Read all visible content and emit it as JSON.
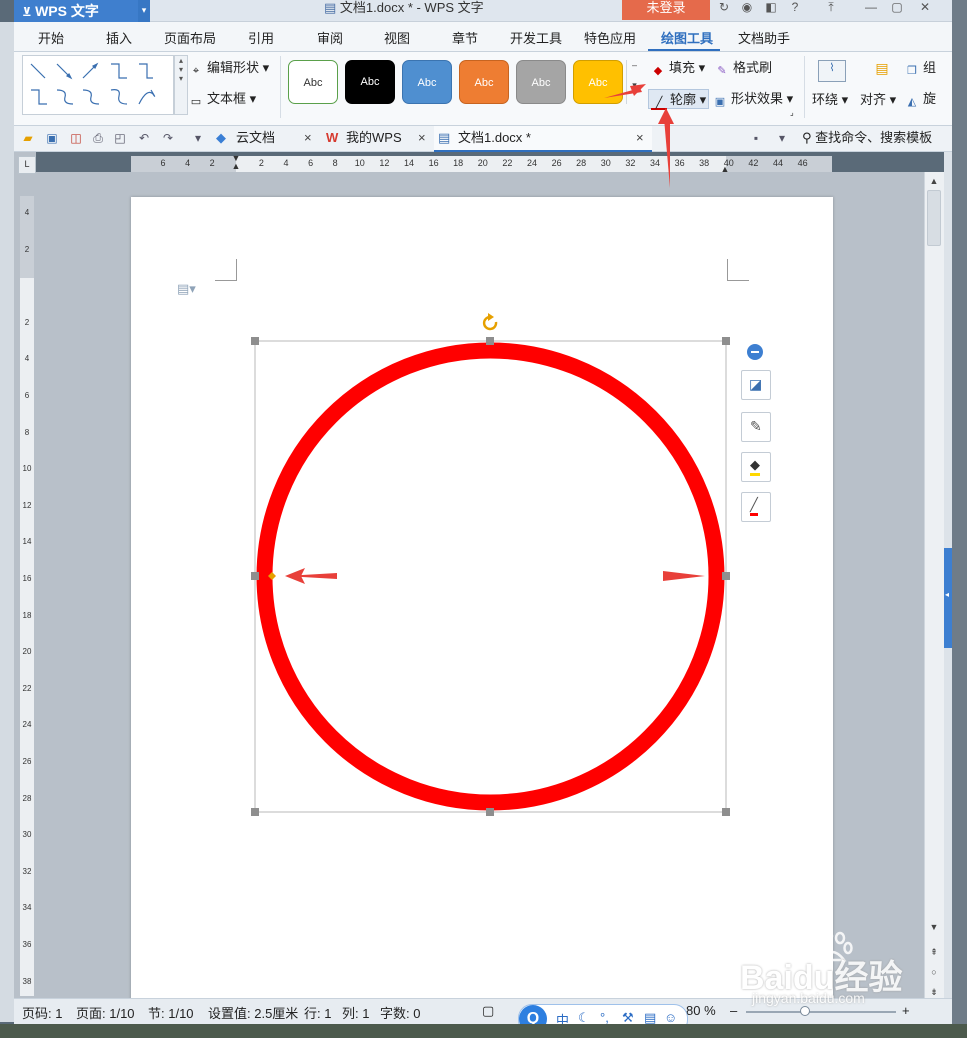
{
  "window": {
    "app_name": "WPS 文字",
    "title": "文档1.docx * - WPS 文字",
    "login_label": "未登录"
  },
  "ribbon_tabs": [
    "开始",
    "插入",
    "页面布局",
    "引用",
    "审阅",
    "视图",
    "章节",
    "开发工具",
    "特色应用",
    "绘图工具",
    "文档助手"
  ],
  "active_tab": "绘图工具",
  "ribbon": {
    "edit_shape_label": "编辑形状",
    "text_box_label": "文本框",
    "style_sample_label": "Abc",
    "style_colors": [
      "#ffffff",
      "#000000",
      "#4f8fd0",
      "#ee7d32",
      "#a5a5a5",
      "#ffc000"
    ],
    "fill_label": "填充",
    "format_painter_label": "格式刷",
    "outline_label": "轮廓",
    "shape_effect_label": "形状效果",
    "wrap_label": "环绕",
    "align_label": "对齐",
    "group_label": "组",
    "rotate_label": "旋"
  },
  "doc_tabs": [
    {
      "label": "云文档",
      "icon": "cloud-doc-icon"
    },
    {
      "label": "我的WPS",
      "icon": "wps-logo-icon"
    },
    {
      "label": "文档1.docx *",
      "icon": "document-icon",
      "active": true
    }
  ],
  "search_command_label": "查找命令、搜索模板",
  "ruler": {
    "h_ticks": [
      "6",
      "4",
      "2",
      "",
      "2",
      "4",
      "6",
      "8",
      "10",
      "12",
      "14",
      "16",
      "18",
      "20",
      "22",
      "24",
      "26",
      "28",
      "30",
      "32",
      "34",
      "36",
      "38",
      "40",
      "42",
      "44",
      "46"
    ],
    "v_ticks": [
      "4",
      "2",
      "",
      "2",
      "4",
      "6",
      "8",
      "10",
      "12",
      "14",
      "16",
      "18",
      "20",
      "22",
      "24",
      "26",
      "28",
      "30",
      "32",
      "34",
      "36",
      "38"
    ]
  },
  "shape": {
    "type": "circle",
    "stroke_color": "#ff0000",
    "fill_color": "#ffffff"
  },
  "annotation_color": "#e8403a",
  "statusbar": {
    "page_code": "页码: 1",
    "pages": "页面: 1/10",
    "section": "节: 1/10",
    "setting": "设置值: 2.5厘米",
    "row": "行: 1",
    "col": "列: 1",
    "words": "字数: 0",
    "zoom": "80 %"
  },
  "ime": {
    "logo": "Q",
    "lang": "中"
  },
  "watermark": {
    "brand": "Baidu经验",
    "url": "jingyan.baidu.com"
  }
}
